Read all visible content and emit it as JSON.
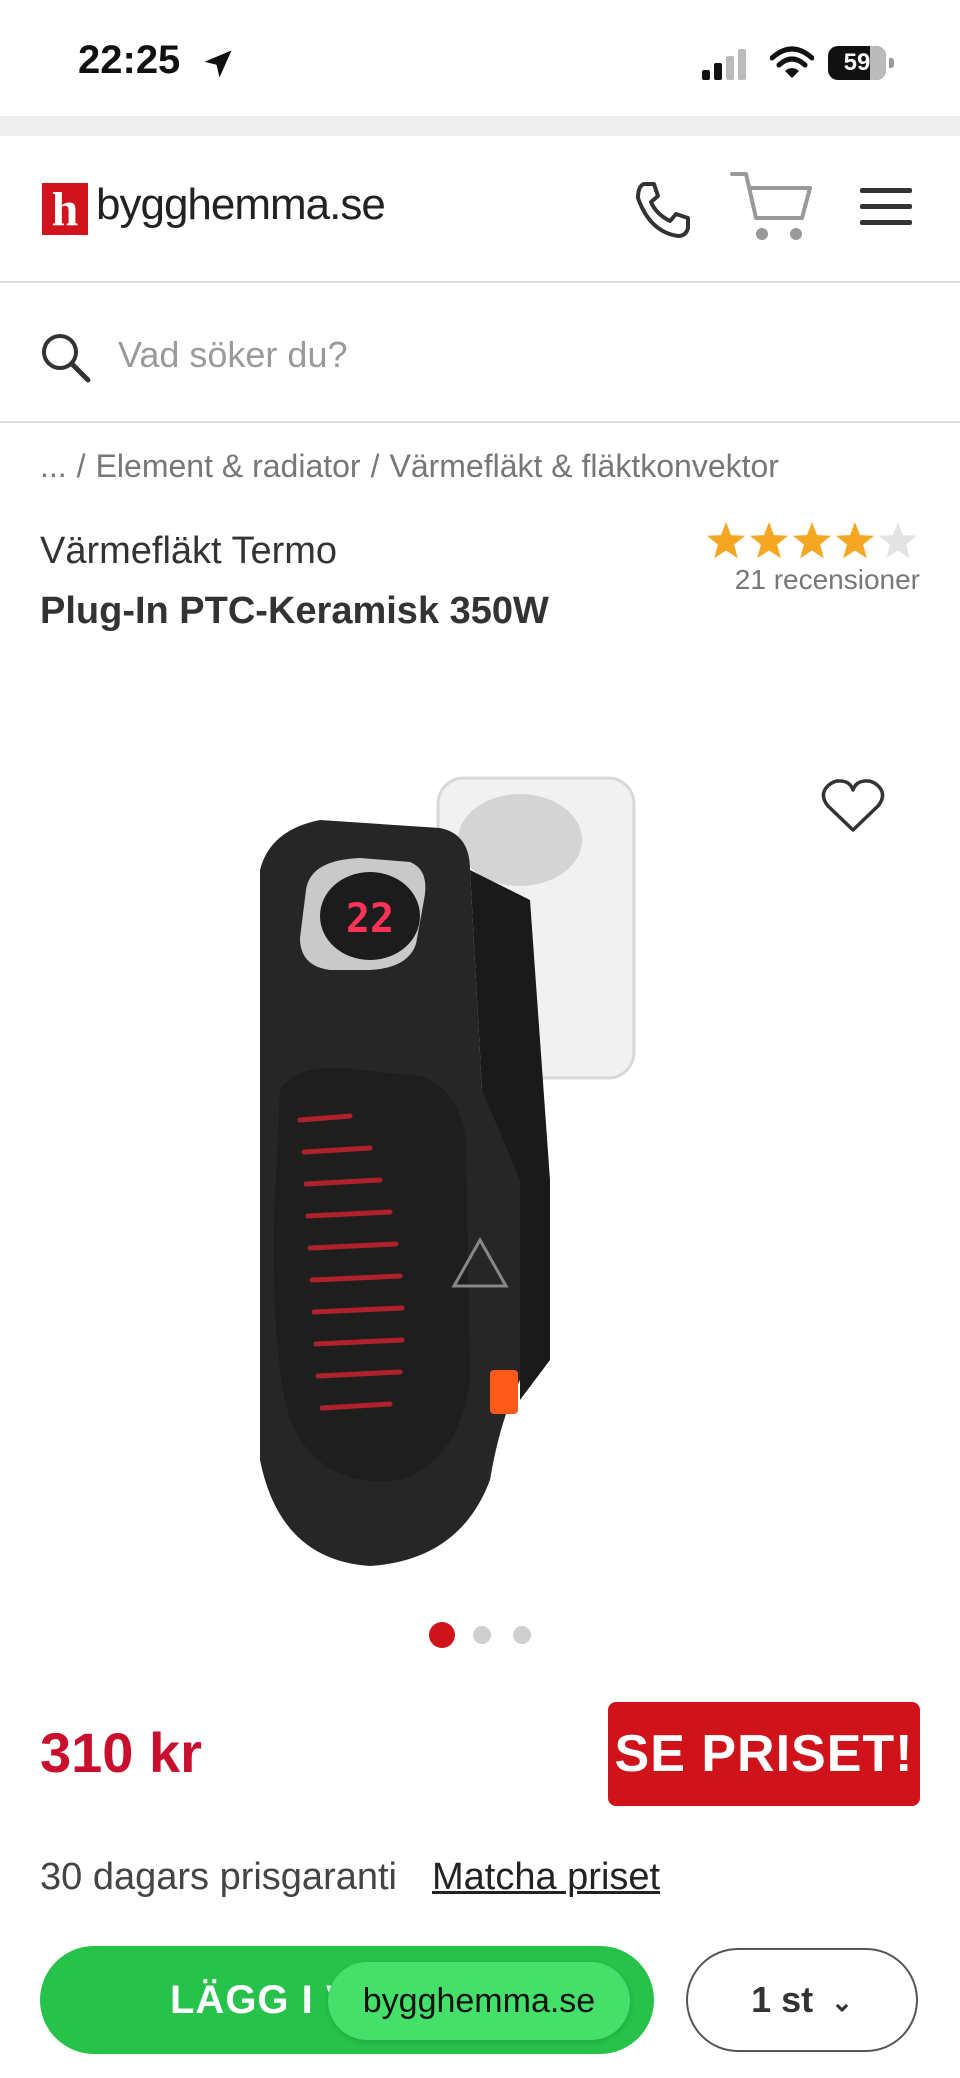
{
  "status_bar": {
    "time": "22:25",
    "battery": "59"
  },
  "header": {
    "logo_letter": "h",
    "logo_text": "bygghemma.se"
  },
  "search": {
    "placeholder": "Vad söker du?"
  },
  "breadcrumb": {
    "ellipsis": "...",
    "items": [
      "Element & radiator",
      "Värmefläkt & fläktkonvektor"
    ]
  },
  "product": {
    "title_line1": "Värmefläkt Termo",
    "title_line2": "Plug-In PTC-Keramisk 350W",
    "rating": 4,
    "rating_max": 5,
    "reviews": "21 recensioner",
    "display_value": "22",
    "carousel": {
      "count": 3,
      "active": 0
    }
  },
  "pricing": {
    "price": "310 kr",
    "cta": "SE PRISET!",
    "guarantee": "30 dagars prisgaranti",
    "match": "Matcha priset"
  },
  "bottom": {
    "add_to_cart": "LÄGG I V",
    "toast": "bygghemma.se",
    "quantity": "1 st"
  },
  "colors": {
    "brand_red": "#d0121b",
    "price_red": "#c8102e",
    "cta_green": "#26c24a",
    "star_orange": "#f5a623"
  },
  "icons": [
    "location-arrow-icon",
    "signal-icon",
    "wifi-icon",
    "battery-icon",
    "phone-icon",
    "cart-icon",
    "menu-icon",
    "search-icon",
    "heart-icon",
    "star-icon",
    "chevron-down-icon"
  ]
}
